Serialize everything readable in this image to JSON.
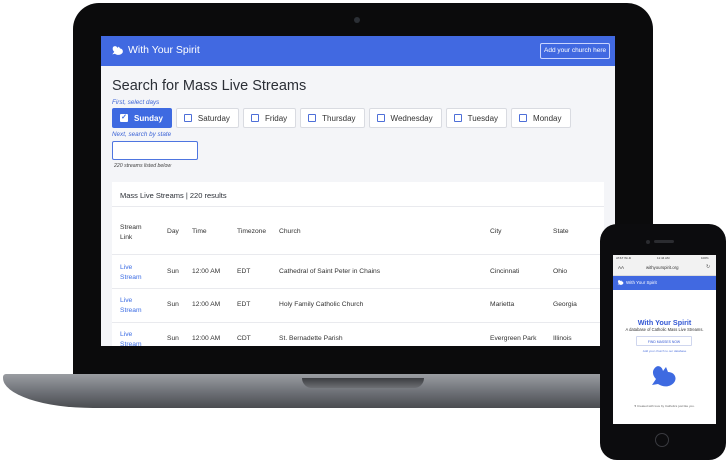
{
  "desktop": {
    "nav": {
      "title": "With Your Spirit",
      "add_church_button": "Add your church here"
    },
    "page_title": "Search for Mass Live Streams",
    "days_hint": "First, select days",
    "days": [
      {
        "label": "Sunday",
        "checked": true
      },
      {
        "label": "Saturday",
        "checked": false
      },
      {
        "label": "Friday",
        "checked": false
      },
      {
        "label": "Thursday",
        "checked": false
      },
      {
        "label": "Wednesday",
        "checked": false
      },
      {
        "label": "Tuesday",
        "checked": false
      },
      {
        "label": "Monday",
        "checked": false
      }
    ],
    "state_hint": "Next, search by state",
    "state_input_value": "",
    "listed_note": "220 streams listed below",
    "results_header": "Mass Live Streams | 220 results",
    "table": {
      "columns": [
        "Stream Link",
        "Day",
        "Time",
        "Timezone",
        "Church",
        "City",
        "State"
      ],
      "rows": [
        {
          "link": "Live Stream",
          "day": "Sun",
          "time": "12:00 AM",
          "timezone": "EDT",
          "church": "Cathedral of Saint Peter in Chains",
          "city": "Cincinnati",
          "state": "Ohio"
        },
        {
          "link": "Live Stream",
          "day": "Sun",
          "time": "12:00 AM",
          "timezone": "EDT",
          "church": "Holy Family Catholic Church",
          "city": "Marietta",
          "state": "Georgia"
        },
        {
          "link": "Live Stream",
          "day": "Sun",
          "time": "12:00 AM",
          "timezone": "CDT",
          "church": "St. Bernadette Parish",
          "city": "Evergreen Park",
          "state": "Illinois"
        }
      ]
    }
  },
  "mobile": {
    "status_left": "AT&T Wi-Fi",
    "status_time": "11:44 AM",
    "status_right": "100%",
    "url_aa": "AA",
    "url": "withyourspirit.org",
    "nav_title": "With Your Spirit",
    "hero_title": "With Your Spirit",
    "hero_subtitle": "A database of Catholic Mass Live Streams.",
    "find_button": "FIND MASSES NOW",
    "add_link": "Add your church to our database",
    "footer": "Created with love by Catholics just like you."
  },
  "colors": {
    "brand_blue": "#4169E1",
    "link_blue": "#3C6DE4"
  },
  "icons": [
    "dove-icon",
    "checkbox-icon",
    "reload-icon",
    "heart-icon"
  ]
}
